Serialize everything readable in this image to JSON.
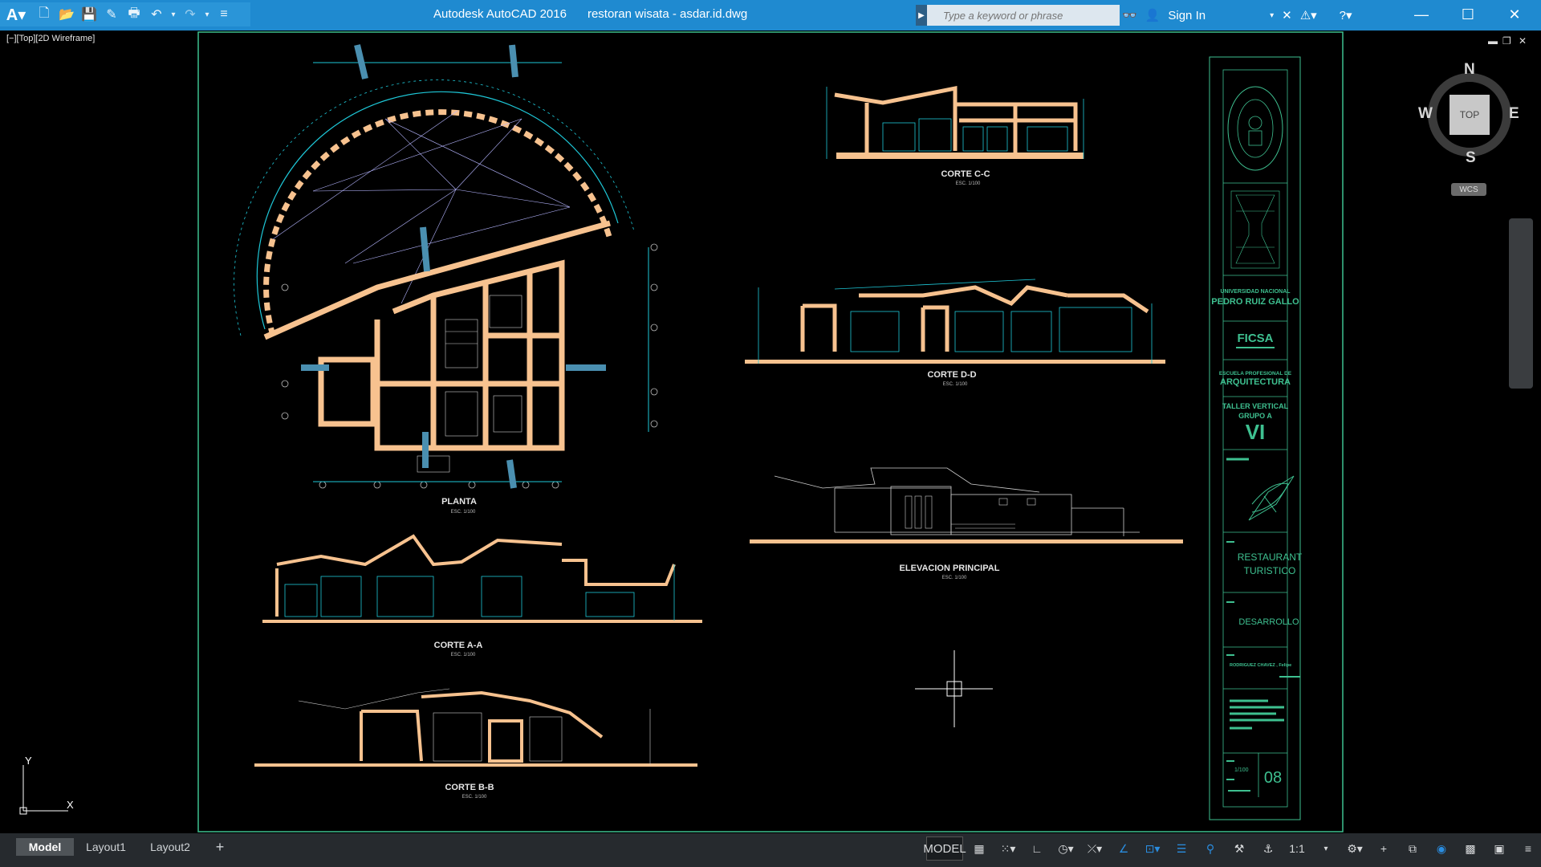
{
  "app": {
    "title": "Autodesk AutoCAD 2016",
    "file": "restoran wisata - asdar.id.dwg"
  },
  "search": {
    "placeholder": "Type a keyword or phrase"
  },
  "account": {
    "sign_in": "Sign In"
  },
  "viewport": {
    "label": "[−][Top][2D Wireframe]"
  },
  "viewcube": {
    "top": "TOP",
    "north": "N",
    "south": "S",
    "east": "E",
    "west": "W",
    "wcs": "WCS"
  },
  "ucs": {
    "x": "X",
    "y": "Y"
  },
  "sheet": {
    "views": {
      "plan": {
        "title": "PLANTA",
        "scale": "ESC. 1/100"
      },
      "section_cc": {
        "title": "CORTE C-C",
        "scale": "ESC. 1/100"
      },
      "section_dd": {
        "title": "CORTE D-D",
        "scale": "ESC. 1/100"
      },
      "elevation": {
        "title": "ELEVACION PRINCIPAL",
        "scale": "ESC. 1/100"
      },
      "section_aa": {
        "title": "CORTE A-A",
        "scale": "ESC. 1/100"
      },
      "section_bb": {
        "title": "CORTE B-B",
        "scale": "ESC. 1/100"
      }
    },
    "title_block": {
      "univ_line1": "UNIVERSIDAD NACIONAL",
      "univ_line2": "PEDRO RUIZ GALLO",
      "faculty": "FICSA",
      "school_line1": "ESCUELA PROFESIONAL DE",
      "school_line2": "ARQUITECTURA",
      "workshop_line1": "TALLER VERTICAL",
      "workshop_line2": "GRUPO A",
      "workshop_line3": "VI",
      "project_line1": "RESTAURANT",
      "project_line2": "TURISTICO",
      "stage": "DESARROLLO",
      "author": "RODRIGUEZ CHAVEZ , Felipe",
      "scale": "1/100",
      "sheet_no": "08"
    }
  },
  "tabs": [
    {
      "label": "Model",
      "active": true
    },
    {
      "label": "Layout1",
      "active": false
    },
    {
      "label": "Layout2",
      "active": false
    }
  ],
  "status": {
    "model": "MODEL",
    "scale": "1:1"
  },
  "colors": {
    "titlebar": "#1f8ad0",
    "walls": "#f7c28f",
    "dims": "#1ec8d8",
    "frame": "#3ec090",
    "background": "#000000"
  }
}
